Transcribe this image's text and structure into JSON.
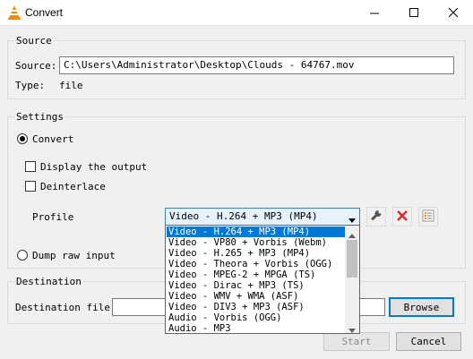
{
  "window": {
    "title": "Convert"
  },
  "source": {
    "group_label": "Source",
    "source_label": "Source:",
    "source_value": "C:\\Users\\Administrator\\Desktop\\Clouds - 64767.mov",
    "type_label": "Type:",
    "type_value": "file"
  },
  "settings": {
    "group_label": "Settings",
    "convert_label": "Convert",
    "convert_selected": true,
    "display_output_label": "Display the output",
    "display_output_checked": false,
    "deinterlace_label": "Deinterlace",
    "deinterlace_checked": false,
    "profile_label": "Profile",
    "profile_selected": "Video - H.264 + MP3 (MP4)",
    "dump_raw_label": "Dump raw input",
    "dump_raw_selected": false
  },
  "profile_options": [
    "Video - H.264 + MP3 (MP4)",
    "Video - VP80 + Vorbis (Webm)",
    "Video - H.265 + MP3 (MP4)",
    "Video - Theora + Vorbis (OGG)",
    "Video - MPEG-2 + MPGA (TS)",
    "Video - Dirac + MP3 (TS)",
    "Video - WMV + WMA (ASF)",
    "Video - DIV3 + MP3 (ASF)",
    "Audio - Vorbis (OGG)",
    "Audio - MP3"
  ],
  "destination": {
    "group_label": "Destination",
    "file_label": "Destination file:",
    "file_value": "",
    "browse_label": "Browse"
  },
  "buttons": {
    "start_label": "Start",
    "cancel_label": "Cancel"
  },
  "colors": {
    "selection": "#0078d7",
    "delete_red": "#d32f2f",
    "vlc_orange": "#f08a00"
  }
}
